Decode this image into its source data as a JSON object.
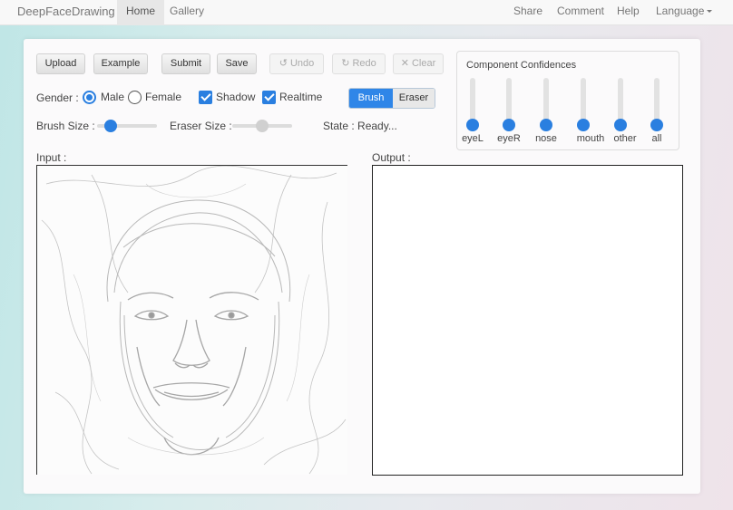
{
  "nav": {
    "brand": "DeepFaceDrawing",
    "home": "Home",
    "gallery": "Gallery",
    "share": "Share",
    "comment": "Comment",
    "help": "Help",
    "language": "Language"
  },
  "toolbar": {
    "upload": "Upload",
    "example": "Example",
    "submit": "Submit",
    "save": "Save",
    "undo": "Undo",
    "redo": "Redo",
    "clear": "Clear"
  },
  "options": {
    "gender_label": "Gender :",
    "male": "Male",
    "female": "Female",
    "gender_selected": "Male",
    "shadow": "Shadow",
    "shadow_checked": true,
    "realtime": "Realtime",
    "realtime_checked": true,
    "brush": "Brush",
    "eraser": "Eraser",
    "tool_selected": "Brush"
  },
  "sizes": {
    "brush_label": "Brush Size :",
    "brush_value": 0.2,
    "eraser_label": "Eraser Size :",
    "eraser_value": 0.5,
    "state": "State : Ready..."
  },
  "confidences": {
    "title": "Component Confidences",
    "items": [
      {
        "label": "eyeL",
        "value": 0
      },
      {
        "label": "eyeR",
        "value": 0
      },
      {
        "label": "nose",
        "value": 0
      },
      {
        "label": "mouth",
        "value": 0
      },
      {
        "label": "other",
        "value": 0
      },
      {
        "label": "all",
        "value": 0
      }
    ]
  },
  "panels": {
    "input_label": "Input :",
    "output_label": "Output :"
  },
  "colors": {
    "accent": "#2a7fe0",
    "brush_active": "#2f86e8"
  }
}
